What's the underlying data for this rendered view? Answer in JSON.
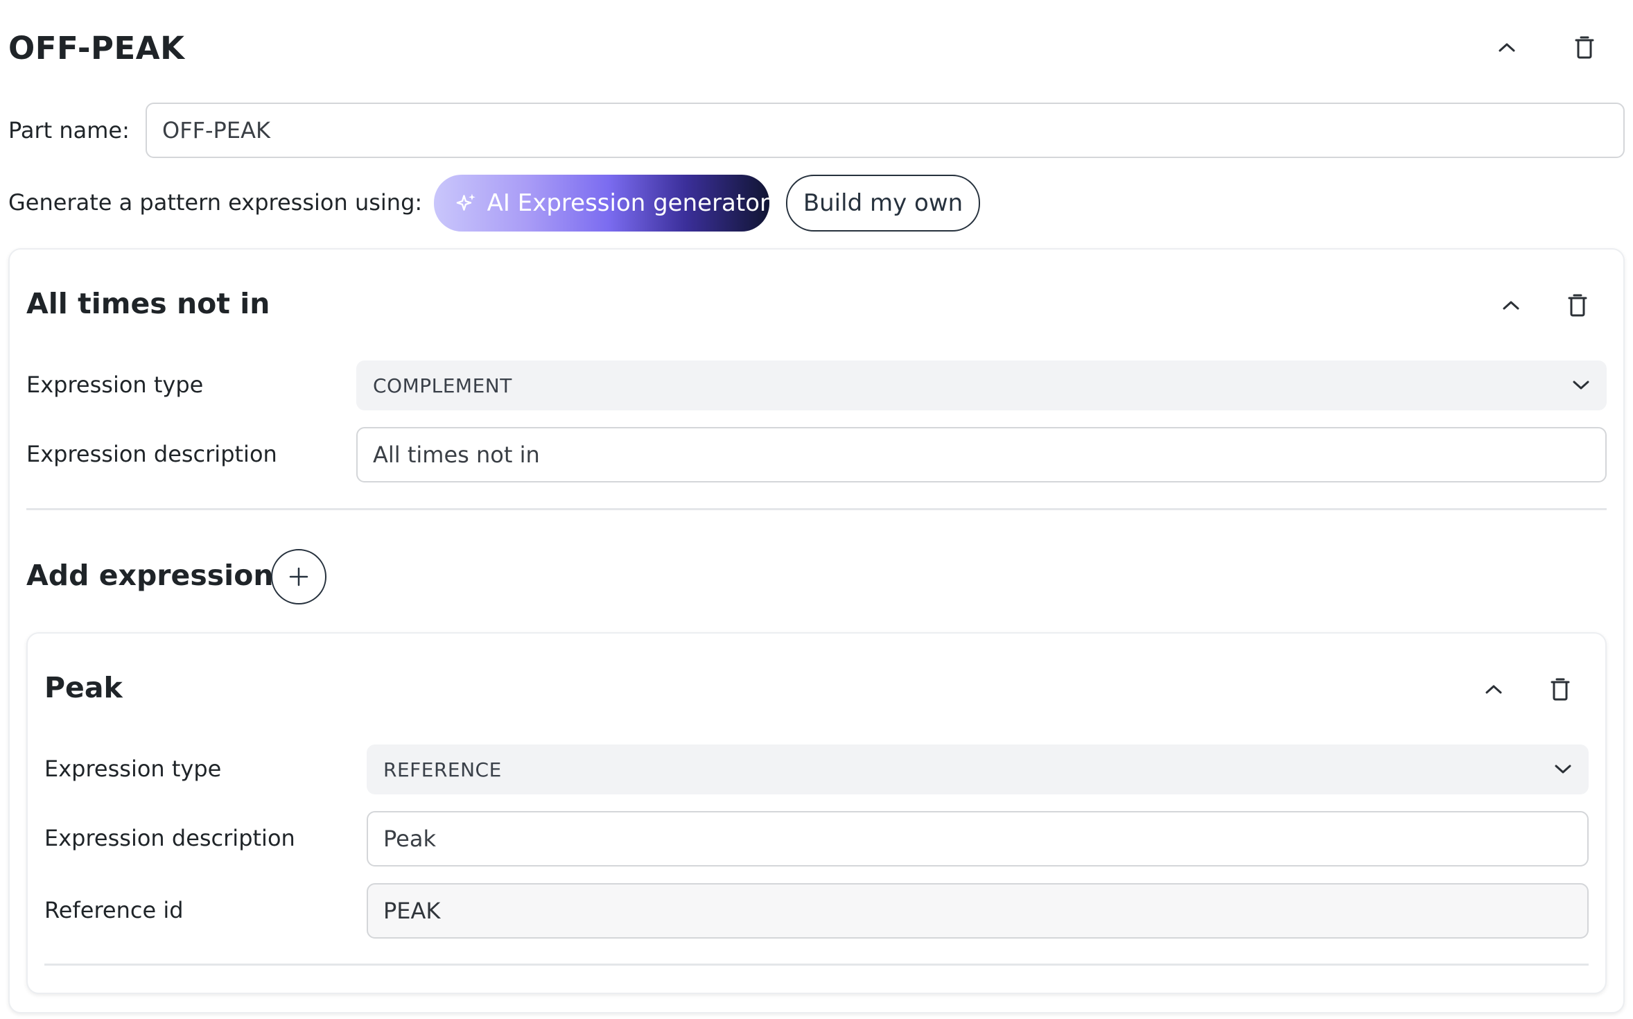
{
  "part": {
    "title": "OFF-PEAK",
    "name_label": "Part name:",
    "name_value": "OFF-PEAK",
    "generate_label": "Generate a pattern expression using:",
    "ai_button_label": "AI Expression generator",
    "build_button_label": "Build my own"
  },
  "outer_expression": {
    "title": "All times not in",
    "type_label": "Expression type",
    "type_value": "COMPLEMENT",
    "description_label": "Expression description",
    "description_value": "All times not in",
    "add_label": "Add expression"
  },
  "inner_expression": {
    "title": "Peak",
    "type_label": "Expression type",
    "type_value": "REFERENCE",
    "description_label": "Expression description",
    "description_value": "Peak",
    "reference_label": "Reference id",
    "reference_value": "PEAK"
  },
  "icons": {
    "collapse": "chevron-up-icon",
    "delete": "trash-icon",
    "dropdown": "chevron-down-icon",
    "add": "plus-icon",
    "ai": "sparkle-icon"
  },
  "colors": {
    "text": "#1f2428",
    "border": "#d4d6d9",
    "select_bg": "#f2f3f5",
    "button_dark": "#26313d",
    "ai_gradient_start": "#c9c6fb",
    "ai_gradient_end": "#111533"
  }
}
